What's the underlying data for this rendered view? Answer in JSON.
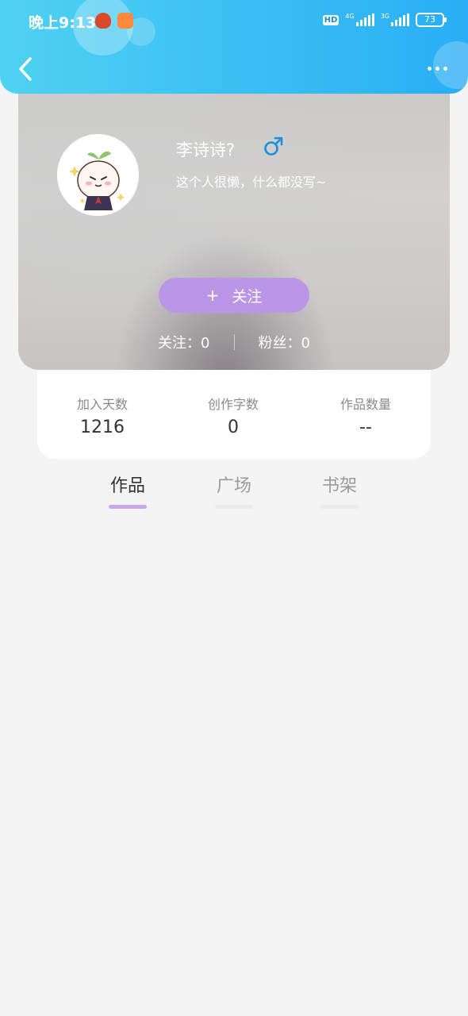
{
  "status_bar": {
    "time": "晚上9:13",
    "hd_label": "HD",
    "network_1": "4G",
    "network_2": "3G",
    "battery": "73"
  },
  "header": {
    "back_icon": "chevron-left-icon",
    "more_icon": "more-horizontal-icon"
  },
  "profile": {
    "name": "李诗诗?",
    "gender_icon": "male-symbol-icon",
    "gender_color": "#1a8ee0",
    "bio": "这个人很懒，什么都没写~",
    "follow_button": {
      "icon": "+",
      "label": "关注",
      "color": "#bb96e6"
    },
    "following": "关注：0",
    "followers": "粉丝：0"
  },
  "stats": [
    {
      "label": "加入天数",
      "value": "1216"
    },
    {
      "label": "创作字数",
      "value": "0"
    },
    {
      "label": "作品数量",
      "value": "--"
    }
  ],
  "tabs": [
    {
      "label": "作品",
      "active": true
    },
    {
      "label": "广场",
      "active": false
    },
    {
      "label": "书架",
      "active": false
    }
  ],
  "colors": {
    "header_gradient_start": "#4fd2f2",
    "header_gradient_end": "#29aef5",
    "active_tab_indicator": "#c9a7ee"
  }
}
